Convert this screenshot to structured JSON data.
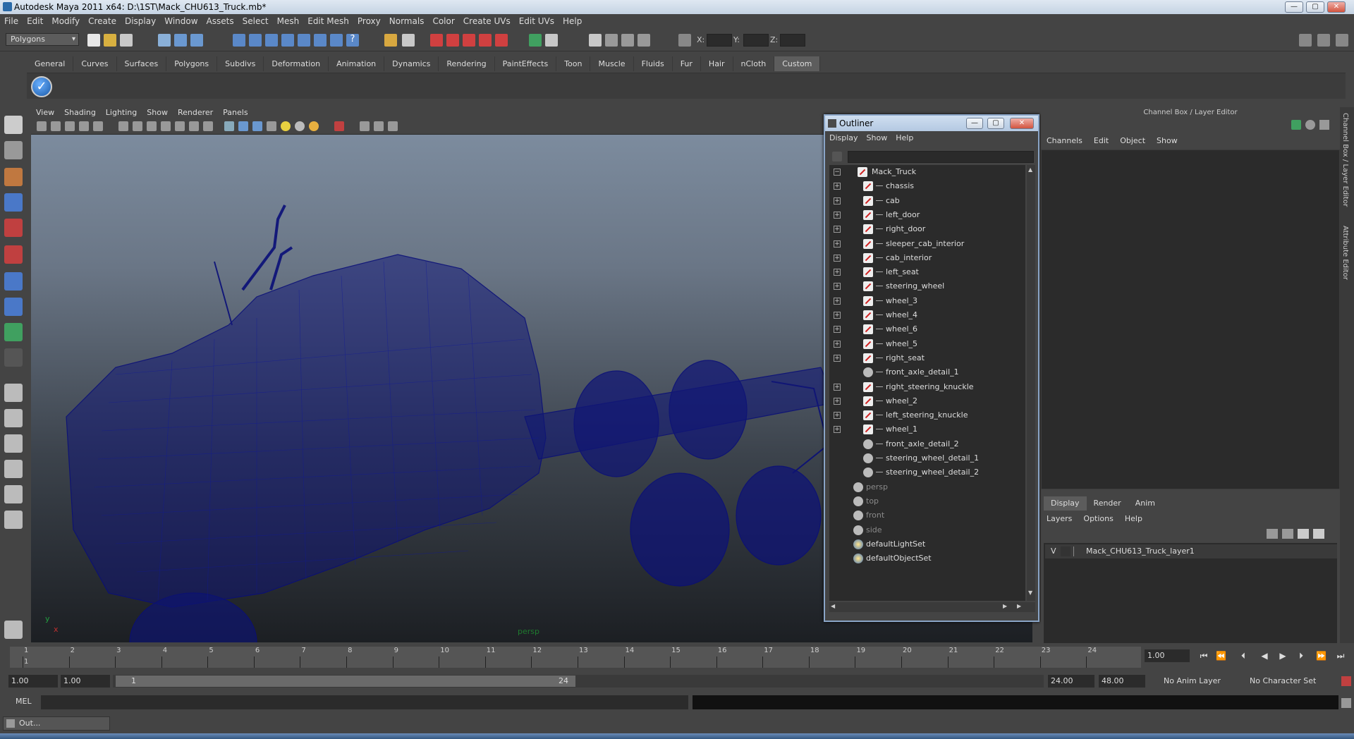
{
  "window": {
    "title": "Autodesk Maya 2011 x64: D:\\1ST\\Mack_CHU613_Truck.mb*"
  },
  "menubar": [
    "File",
    "Edit",
    "Modify",
    "Create",
    "Display",
    "Window",
    "Assets",
    "Select",
    "Mesh",
    "Edit Mesh",
    "Proxy",
    "Normals",
    "Color",
    "Create UVs",
    "Edit UVs",
    "Help"
  ],
  "status": {
    "menuset": "Polygons",
    "x_label": "X:",
    "y_label": "Y:",
    "z_label": "Z:"
  },
  "shelf": {
    "tabs": [
      "General",
      "Curves",
      "Surfaces",
      "Polygons",
      "Subdivs",
      "Deformation",
      "Animation",
      "Dynamics",
      "Rendering",
      "PaintEffects",
      "Toon",
      "Muscle",
      "Fluids",
      "Fur",
      "Hair",
      "nCloth",
      "Custom"
    ],
    "active_tab": "Custom"
  },
  "viewport": {
    "menu": [
      "View",
      "Shading",
      "Lighting",
      "Show",
      "Renderer",
      "Panels"
    ],
    "camera_label": "persp",
    "axis_y": "y",
    "axis_x": "x"
  },
  "outliner": {
    "title": "Outliner",
    "menu": [
      "Display",
      "Show",
      "Help"
    ],
    "items": [
      {
        "label": "Mack_Truck",
        "type": "mesh",
        "expand": "−",
        "depth": 0
      },
      {
        "label": "chassis",
        "type": "mesh",
        "expand": "+",
        "depth": 1
      },
      {
        "label": "cab",
        "type": "mesh",
        "expand": "+",
        "depth": 1
      },
      {
        "label": "left_door",
        "type": "mesh",
        "expand": "+",
        "depth": 1
      },
      {
        "label": "right_door",
        "type": "mesh",
        "expand": "+",
        "depth": 1
      },
      {
        "label": "sleeper_cab_interior",
        "type": "mesh",
        "expand": "+",
        "depth": 1
      },
      {
        "label": "cab_interior",
        "type": "mesh",
        "expand": "+",
        "depth": 1
      },
      {
        "label": "left_seat",
        "type": "mesh",
        "expand": "+",
        "depth": 1
      },
      {
        "label": "steering_wheel",
        "type": "mesh",
        "expand": "+",
        "depth": 1
      },
      {
        "label": "wheel_3",
        "type": "mesh",
        "expand": "+",
        "depth": 1
      },
      {
        "label": "wheel_4",
        "type": "mesh",
        "expand": "+",
        "depth": 1
      },
      {
        "label": "wheel_6",
        "type": "mesh",
        "expand": "+",
        "depth": 1
      },
      {
        "label": "wheel_5",
        "type": "mesh",
        "expand": "+",
        "depth": 1
      },
      {
        "label": "right_seat",
        "type": "mesh",
        "expand": "+",
        "depth": 1
      },
      {
        "label": "front_axle_detail_1",
        "type": "cam",
        "expand": "",
        "depth": 1
      },
      {
        "label": "right_steering_knuckle",
        "type": "mesh",
        "expand": "+",
        "depth": 1
      },
      {
        "label": "wheel_2",
        "type": "mesh",
        "expand": "+",
        "depth": 1
      },
      {
        "label": "left_steering_knuckle",
        "type": "mesh",
        "expand": "+",
        "depth": 1
      },
      {
        "label": "wheel_1",
        "type": "mesh",
        "expand": "+",
        "depth": 1
      },
      {
        "label": "front_axle_detail_2",
        "type": "cam",
        "expand": "",
        "depth": 1
      },
      {
        "label": "steering_wheel_detail_1",
        "type": "cam",
        "expand": "",
        "depth": 1
      },
      {
        "label": "steering_wheel_detail_2",
        "type": "cam",
        "expand": "",
        "depth": 1
      },
      {
        "label": "persp",
        "type": "cam",
        "expand": "",
        "depth": 0,
        "dim": true
      },
      {
        "label": "top",
        "type": "cam",
        "expand": "",
        "depth": 0,
        "dim": true
      },
      {
        "label": "front",
        "type": "cam",
        "expand": "",
        "depth": 0,
        "dim": true
      },
      {
        "label": "side",
        "type": "cam",
        "expand": "",
        "depth": 0,
        "dim": true
      },
      {
        "label": "defaultLightSet",
        "type": "set",
        "expand": "",
        "depth": 0
      },
      {
        "label": "defaultObjectSet",
        "type": "set",
        "expand": "",
        "depth": 0
      }
    ]
  },
  "channelbox": {
    "header": "Channel Box / Layer Editor",
    "menu": [
      "Channels",
      "Edit",
      "Object",
      "Show"
    ],
    "layer_tabs": [
      "Display",
      "Render",
      "Anim"
    ],
    "layer_menu": [
      "Layers",
      "Options",
      "Help"
    ],
    "layer": {
      "visibility": "V",
      "name": "Mack_CHU613_Truck_layer1"
    }
  },
  "side_tabs": [
    "Channel Box / Layer Editor",
    "Attribute Editor"
  ],
  "timeline": {
    "ticks": [
      "1",
      "2",
      "3",
      "4",
      "5",
      "6",
      "7",
      "8",
      "9",
      "10",
      "11",
      "12",
      "13",
      "14",
      "15",
      "16",
      "17",
      "18",
      "19",
      "20",
      "21",
      "22",
      "23",
      "24"
    ],
    "current_frame_marker": "1",
    "current_frame": "1.00"
  },
  "range": {
    "start": "1.00",
    "playback_start": "1.00",
    "range_start_label": "1",
    "range_end_label": "24",
    "playback_end": "24.00",
    "end": "48.00",
    "anim_layer": "No Anim Layer",
    "character_set": "No Character Set"
  },
  "cmd": {
    "label": "MEL"
  },
  "taskbar": {
    "minimized": "Out..."
  },
  "colors": {
    "wireframe": "#0a0f78",
    "selected_tab": "#5d5d5d"
  }
}
